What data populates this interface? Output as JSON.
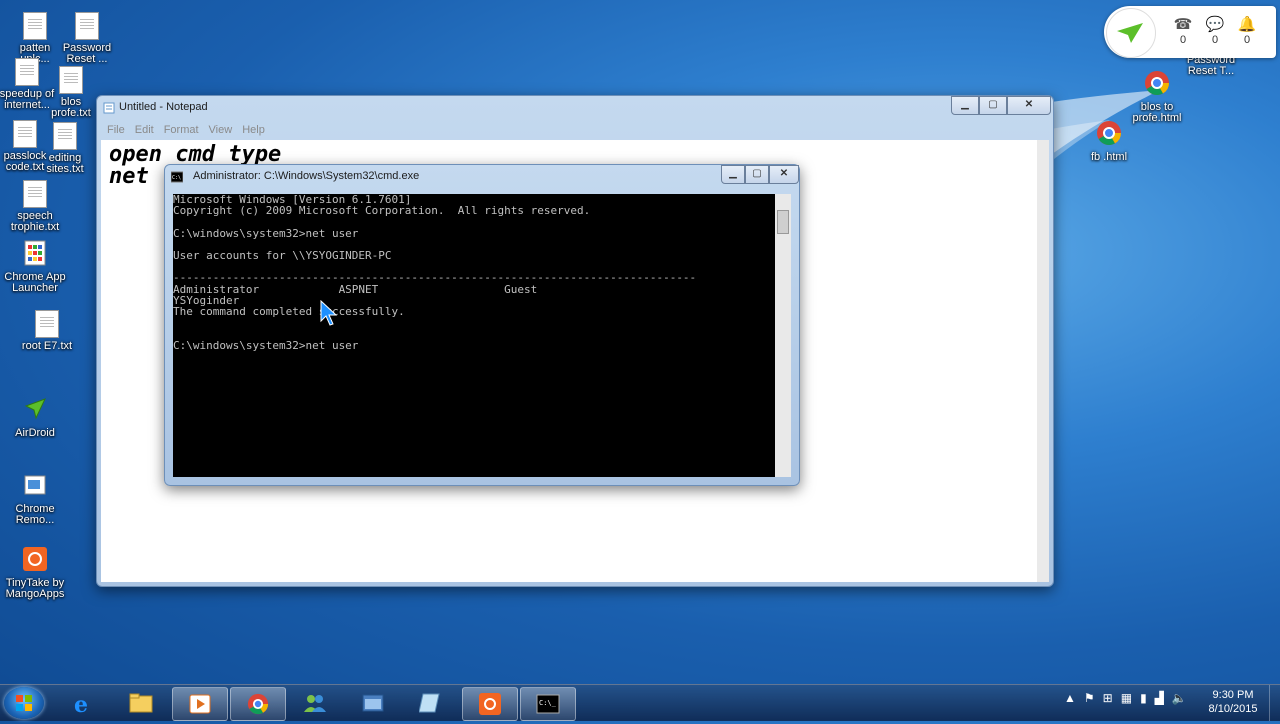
{
  "desktop_left_icons": [
    {
      "label": "patten\nunlc..."
    },
    {
      "label": "Password\nReset ..."
    },
    {
      "label": "speedup of\ninternet..."
    },
    {
      "label": "blos\nprofe.txt"
    },
    {
      "label": "passlock\ncode.txt"
    },
    {
      "label": "editing\nsites.txt"
    },
    {
      "label": "speech\ntrophie.txt"
    },
    {
      "label": "Chrome App\nLauncher"
    },
    {
      "label": "root E7.txt"
    },
    {
      "label": "AirDroid"
    },
    {
      "label": "Chrome\nRemo..."
    },
    {
      "label": "TinyTake by\nMangoApps"
    }
  ],
  "desktop_right_icons": [
    {
      "label": "Password\nReset T..."
    },
    {
      "label": "blos to\nprofe.html"
    },
    {
      "label": "fb .html"
    }
  ],
  "airdroid_widget": {
    "calls": "0",
    "messages": "0",
    "notifications": "0"
  },
  "notepad": {
    "title": "Untitled - Notepad",
    "menu": [
      "File",
      "Edit",
      "Format",
      "View",
      "Help"
    ],
    "text_line1": "open cmd type",
    "text_line2": "net"
  },
  "cmd": {
    "title": "Administrator: C:\\Windows\\System32\\cmd.exe",
    "lines": [
      "Microsoft Windows [Version 6.1.7601]",
      "Copyright (c) 2009 Microsoft Corporation.  All rights reserved.",
      "",
      "C:\\windows\\system32>net user",
      "",
      "User accounts for \\\\YSYOGINDER-PC",
      "",
      "-------------------------------------------------------------------------------",
      "Administrator            ASPNET                   Guest",
      "YSYoginder",
      "The command completed successfully.",
      "",
      "",
      "C:\\windows\\system32>net user"
    ]
  },
  "taskbar": {
    "time": "9:30 PM",
    "date": "8/10/2015"
  },
  "colors": {
    "desktop": "#1a5fae",
    "cmd_bg": "#000000",
    "cmd_fg": "#c0c0c0"
  }
}
